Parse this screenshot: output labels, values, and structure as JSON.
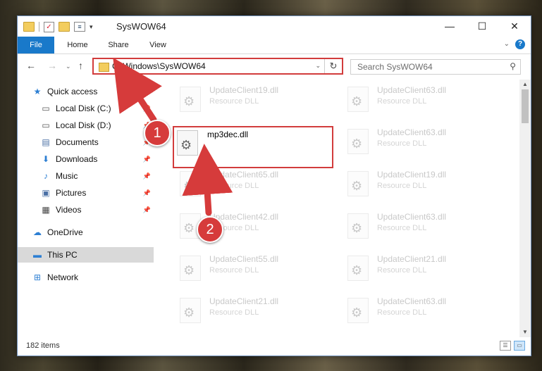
{
  "window": {
    "title": "SysWOW64",
    "controls": {
      "minimize": "—",
      "maximize": "☐",
      "close": "✕"
    }
  },
  "ribbon": {
    "tabs": [
      "File",
      "Home",
      "Share",
      "View"
    ],
    "help": "?"
  },
  "address": {
    "path": "C:\\Windows\\SysWOW64",
    "search_placeholder": "Search SysWOW64"
  },
  "sidebar": {
    "items": [
      {
        "label": "Quick access",
        "icon": "star-icon",
        "glyph": "★"
      },
      {
        "label": "Local Disk (C:)",
        "icon": "drive-icon",
        "glyph": "▭",
        "pinned": true
      },
      {
        "label": "Local Disk (D:)",
        "icon": "drive-icon",
        "glyph": "▭",
        "pinned": true
      },
      {
        "label": "Documents",
        "icon": "documents-icon",
        "glyph": "▤",
        "pinned": true
      },
      {
        "label": "Downloads",
        "icon": "downloads-icon",
        "glyph": "⬇",
        "pinned": true
      },
      {
        "label": "Music",
        "icon": "music-icon",
        "glyph": "♪",
        "pinned": true
      },
      {
        "label": "Pictures",
        "icon": "pictures-icon",
        "glyph": "▣",
        "pinned": true
      },
      {
        "label": "Videos",
        "icon": "videos-icon",
        "glyph": "▦",
        "pinned": true
      },
      {
        "label": "OneDrive",
        "icon": "cloud-icon",
        "glyph": "☁"
      },
      {
        "label": "This PC",
        "icon": "computer-icon",
        "glyph": "▬",
        "selected": true
      },
      {
        "label": "Network",
        "icon": "network-icon",
        "glyph": "⊞"
      }
    ]
  },
  "files": [
    {
      "name": "UpdateClient19.dll",
      "type": "Resource DLL"
    },
    {
      "name": "UpdateClient63.dll",
      "type": "Resource DLL"
    },
    {
      "name": "mp3dec.dll",
      "type": "",
      "highlighted": true
    },
    {
      "name": "UpdateClient63.dll",
      "type": "Resource DLL"
    },
    {
      "name": "UpdateClient65.dll",
      "type": "Resource DLL"
    },
    {
      "name": "UpdateClient19.dll",
      "type": "Resource DLL"
    },
    {
      "name": "UpdateClient42.dll",
      "type": "Resource DLL"
    },
    {
      "name": "UpdateClient63.dll",
      "type": "Resource DLL"
    },
    {
      "name": "UpdateClient55.dll",
      "type": "Resource DLL"
    },
    {
      "name": "UpdateClient21.dll",
      "type": "Resource DLL"
    },
    {
      "name": "UpdateClient21.dll",
      "type": "Resource DLL"
    },
    {
      "name": "UpdateClient63.dll",
      "type": "Resource DLL"
    }
  ],
  "status": {
    "item_count": "182 items"
  },
  "annotations": {
    "step1": "1",
    "step2": "2",
    "color": "#d63b3b"
  }
}
